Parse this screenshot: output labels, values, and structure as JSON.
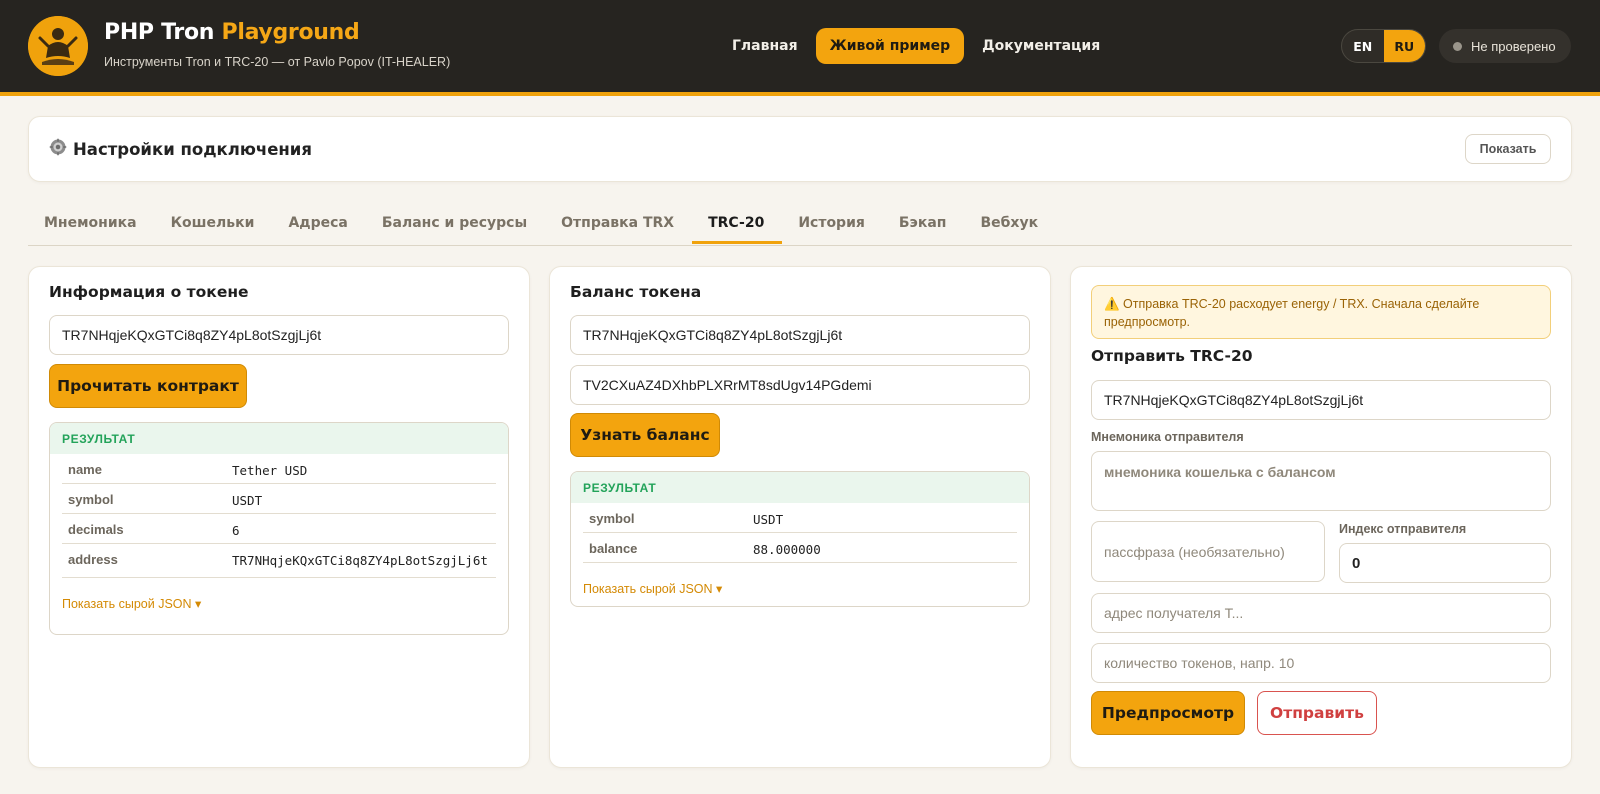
{
  "header": {
    "title_main": "PHP Tron",
    "title_accent": "Playground",
    "subtitle": "Инструменты Tron и TRC-20 — от Pavlo Popov (IT-HEALER)",
    "nav": [
      "Главная",
      "Живой пример",
      "Документация"
    ],
    "nav_active": "Живой пример",
    "lang": [
      "EN",
      "RU"
    ],
    "lang_active": "RU",
    "status": "Не проверено"
  },
  "settings": {
    "title": "Настройки подключения",
    "show_label": "Показать",
    "icon": "gear-icon"
  },
  "tabs": [
    "Мнемоника",
    "Кошельки",
    "Адреса",
    "Баланс и ресурсы",
    "Отправка TRX",
    "TRC-20",
    "История",
    "Бэкап",
    "Вебхук"
  ],
  "tab_active": "TRC-20",
  "token_info": {
    "title": "Информация о токене",
    "contract_value": "TR7NHqjeKQxGTCi8q8ZY4pL8otSzgjLj6t",
    "button": "Прочитать контракт",
    "result_title": "РЕЗУЛЬТАТ",
    "rows": [
      {
        "key": "name",
        "value": "Tether USD"
      },
      {
        "key": "symbol",
        "value": "USDT"
      },
      {
        "key": "decimals",
        "value": "6"
      },
      {
        "key": "address",
        "value": "TR7NHqjeKQxGTCi8q8ZY4pL8otSzgjLj6t"
      }
    ],
    "raw_label": "Показать сырой JSON ▾"
  },
  "token_balance": {
    "title": "Баланс токена",
    "contract_value": "TR7NHqjeKQxGTCi8q8ZY4pL8otSzgjLj6t",
    "address_value": "TV2CXuAZ4DXhbPLXRrMT8sdUgv14PGdemi",
    "button": "Узнать баланс",
    "result_title": "РЕЗУЛЬТАТ",
    "rows": [
      {
        "key": "symbol",
        "value": "USDT"
      },
      {
        "key": "balance",
        "value": "88.000000"
      }
    ],
    "raw_label": "Показать сырой JSON ▾"
  },
  "send_trc20": {
    "warning": "⚠️ Отправка TRC-20 расходует energy / TRX. Сначала сделайте предпросмотр.",
    "title": "Отправить TRC-20",
    "contract_value": "TR7NHqjeKQxGTCi8q8ZY4pL8otSzgjLj6t",
    "mnemonic_label": "Мнемоника отправителя",
    "mnemonic_placeholder": "мнемоника кошелька с балансом",
    "passphrase_placeholder": "пассфраза (необязательно)",
    "index_label": "Индекс отправителя",
    "index_value": "0",
    "recipient_placeholder": "адрес получателя T...",
    "amount_placeholder": "количество токенов, напр. 10",
    "preview_button": "Предпросмотр",
    "send_button": "Отправить"
  },
  "colors": {
    "accent": "#f3a40e",
    "header_bg": "#262420",
    "success": "#23a35a",
    "danger": "#d04040"
  }
}
